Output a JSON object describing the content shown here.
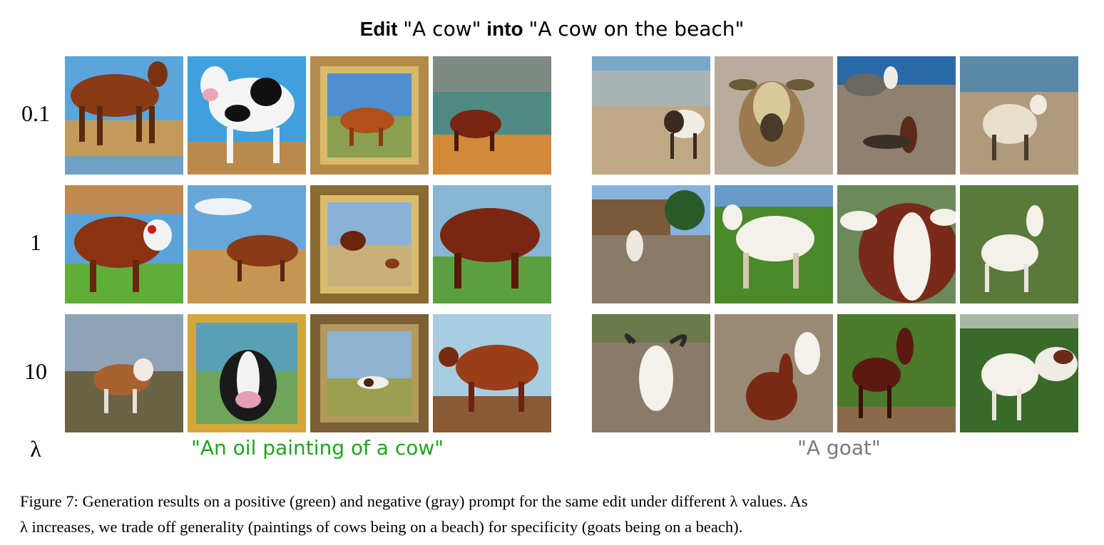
{
  "title": {
    "edit_word": "Edit",
    "source_prompt": "\"A cow\"",
    "into_word": "into",
    "target_prompt": "\"A cow on the beach\""
  },
  "row_labels": [
    "0.1",
    "1",
    "10"
  ],
  "axis_symbol": "λ",
  "left_panel": {
    "prompt": "\"An oil painting of a cow\"",
    "prompt_color": "#1fa31f",
    "tiles": [
      [
        "oil painting of brown cow on beach",
        "cartoon black-and-white cow",
        "framed painting of brown cow",
        "painting of brown cow by sea"
      ],
      [
        "painting of brown cow on canvas",
        "painting of brown cow on beach",
        "framed painting of cow at sea",
        "painting of brown bull"
      ],
      [
        "painting of cow with horns",
        "framed painting of cow face",
        "framed painting of small cow",
        "painting of brown cow"
      ]
    ]
  },
  "right_panel": {
    "prompt": "\"A goat\"",
    "prompt_color": "#7a7a7a",
    "tiles": [
      [
        "photo of goat on beach",
        "close-up of goat face",
        "photo of goats on rocks",
        "photo of goat on beach"
      ],
      [
        "photo of goat near hut",
        "photo of white goat on grass",
        "close-up of goat head",
        "photo of white goat on grass"
      ],
      [
        "photo of white goat with horns",
        "photo of brown goat",
        "photo of brown goat on grass",
        "photo of two goats"
      ]
    ]
  },
  "caption": {
    "line1": "Figure 7: Generation results on a positive (green) and negative (gray) prompt for the same edit under different λ values. As",
    "line2": "λ increases, we trade off generality (paintings of cows being on a beach) for specificity (goats being on a beach)."
  },
  "colors": {
    "positive": "#1fa31f",
    "negative": "#7a7a7a"
  }
}
